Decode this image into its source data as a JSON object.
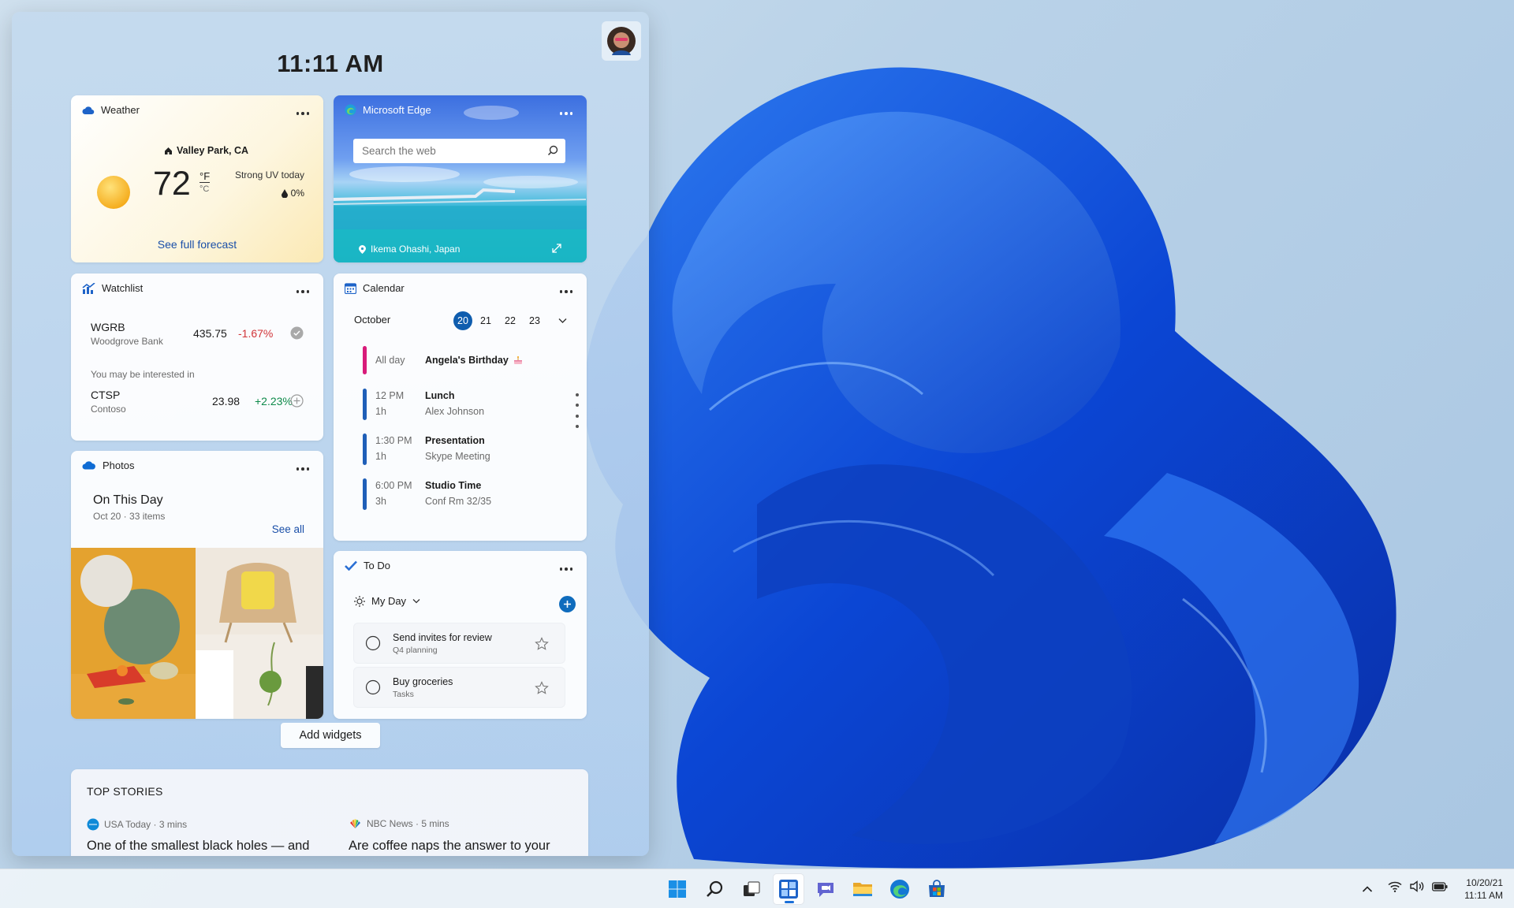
{
  "clock": "11:11 AM",
  "weather": {
    "title": "Weather",
    "location": "Valley Park, CA",
    "temp": "72",
    "unit_f": "°F",
    "unit_c": "°C",
    "condition": "Strong UV today",
    "precip": "0%",
    "link": "See full forecast"
  },
  "edge": {
    "title": "Microsoft Edge",
    "search_placeholder": "Search the web",
    "location": "Ikema Ohashi, Japan"
  },
  "watchlist": {
    "title": "Watchlist",
    "stocks": [
      {
        "symbol": "WGRB",
        "name": "Woodgrove Bank",
        "price": "435.75",
        "change": "-1.67%"
      },
      {
        "symbol": "CTSP",
        "name": "Contoso",
        "price": "23.98",
        "change": "+2.23%"
      }
    ],
    "interest_label": "You may be interested in"
  },
  "calendar": {
    "title": "Calendar",
    "month": "October",
    "days": [
      "20",
      "21",
      "22",
      "23"
    ],
    "events": [
      {
        "time": "All day",
        "duration": "",
        "title": "Angela's Birthday",
        "detail": ""
      },
      {
        "time": "12 PM",
        "duration": "1h",
        "title": "Lunch",
        "detail": "Alex  Johnson"
      },
      {
        "time": "1:30 PM",
        "duration": "1h",
        "title": "Presentation",
        "detail": "Skype Meeting"
      },
      {
        "time": "6:00 PM",
        "duration": "3h",
        "title": "Studio Time",
        "detail": "Conf Rm 32/35"
      }
    ]
  },
  "photos": {
    "title": "Photos",
    "heading": "On This Day",
    "sub": "Oct 20 · 33 items",
    "see_all": "See all"
  },
  "todo": {
    "title": "To Do",
    "list": "My Day",
    "tasks": [
      {
        "title": "Send invites for review",
        "list": "Q4 planning"
      },
      {
        "title": "Buy groceries",
        "list": "Tasks"
      }
    ]
  },
  "add_widgets": "Add widgets",
  "stories": {
    "header": "TOP STORIES",
    "items": [
      {
        "source": "USA Today · 3 mins",
        "headline": "One of the smallest black holes — and"
      },
      {
        "source": "NBC News · 5 mins",
        "headline": "Are coffee naps the answer to your"
      }
    ]
  },
  "tray": {
    "date": "10/20/21",
    "time": "11:11 AM"
  },
  "colors": {
    "accent": "#0f6cbd",
    "negative": "#d13438",
    "positive": "#0e8a4a",
    "birthday": "#d81b7a",
    "event": "#1f5fb8"
  }
}
